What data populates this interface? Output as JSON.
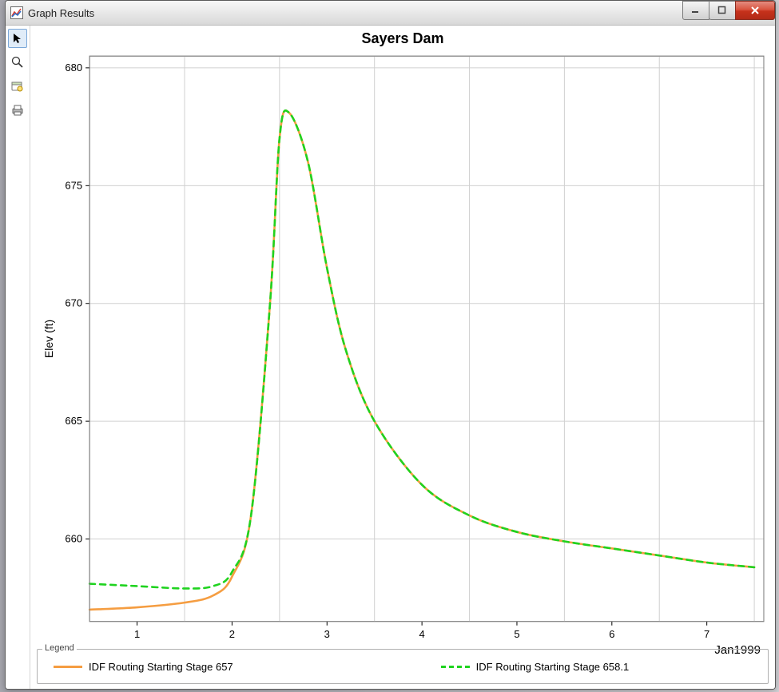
{
  "window": {
    "title": "Graph Results"
  },
  "toolbar": {
    "pointer": "pointer",
    "zoom": "zoom",
    "properties": "properties",
    "print": "print"
  },
  "legend": {
    "label": "Legend",
    "items": [
      "IDF Routing Starting Stage 657",
      "IDF Routing Starting Stage 658.1"
    ]
  },
  "chart_data": {
    "type": "line",
    "title": "Sayers Dam",
    "ylabel": "Elev (ft)",
    "xlabel": "Jan1999",
    "x": [
      0.5,
      1.0,
      1.5,
      1.8,
      2.0,
      2.2,
      2.4,
      2.5,
      2.6,
      2.8,
      3.0,
      3.2,
      3.5,
      4.0,
      4.5,
      5.0,
      5.5,
      6.0,
      6.5,
      7.0,
      7.5
    ],
    "x_ticks": [
      1,
      2,
      3,
      4,
      5,
      6,
      7
    ],
    "y_ticks": [
      660,
      665,
      670,
      675,
      680
    ],
    "xlim": [
      0.5,
      7.6
    ],
    "ylim": [
      656.5,
      680.5
    ],
    "series": [
      {
        "name": "IDF Routing Starting Stage 657",
        "color": "#f59d41",
        "dash": "none",
        "values": [
          657.0,
          657.1,
          657.3,
          657.6,
          658.4,
          661.0,
          670.0,
          677.0,
          678.1,
          676.0,
          671.5,
          668.0,
          665.0,
          662.3,
          661.0,
          660.3,
          659.9,
          659.6,
          659.3,
          659.0,
          658.8
        ]
      },
      {
        "name": "IDF Routing Starting Stage 658.1",
        "color": "#1fd31f",
        "dash": "7 6",
        "values": [
          658.1,
          658.0,
          657.9,
          658.0,
          658.6,
          661.0,
          670.0,
          677.0,
          678.1,
          676.0,
          671.5,
          668.0,
          665.0,
          662.3,
          661.0,
          660.3,
          659.9,
          659.6,
          659.3,
          659.0,
          658.8
        ]
      }
    ]
  }
}
